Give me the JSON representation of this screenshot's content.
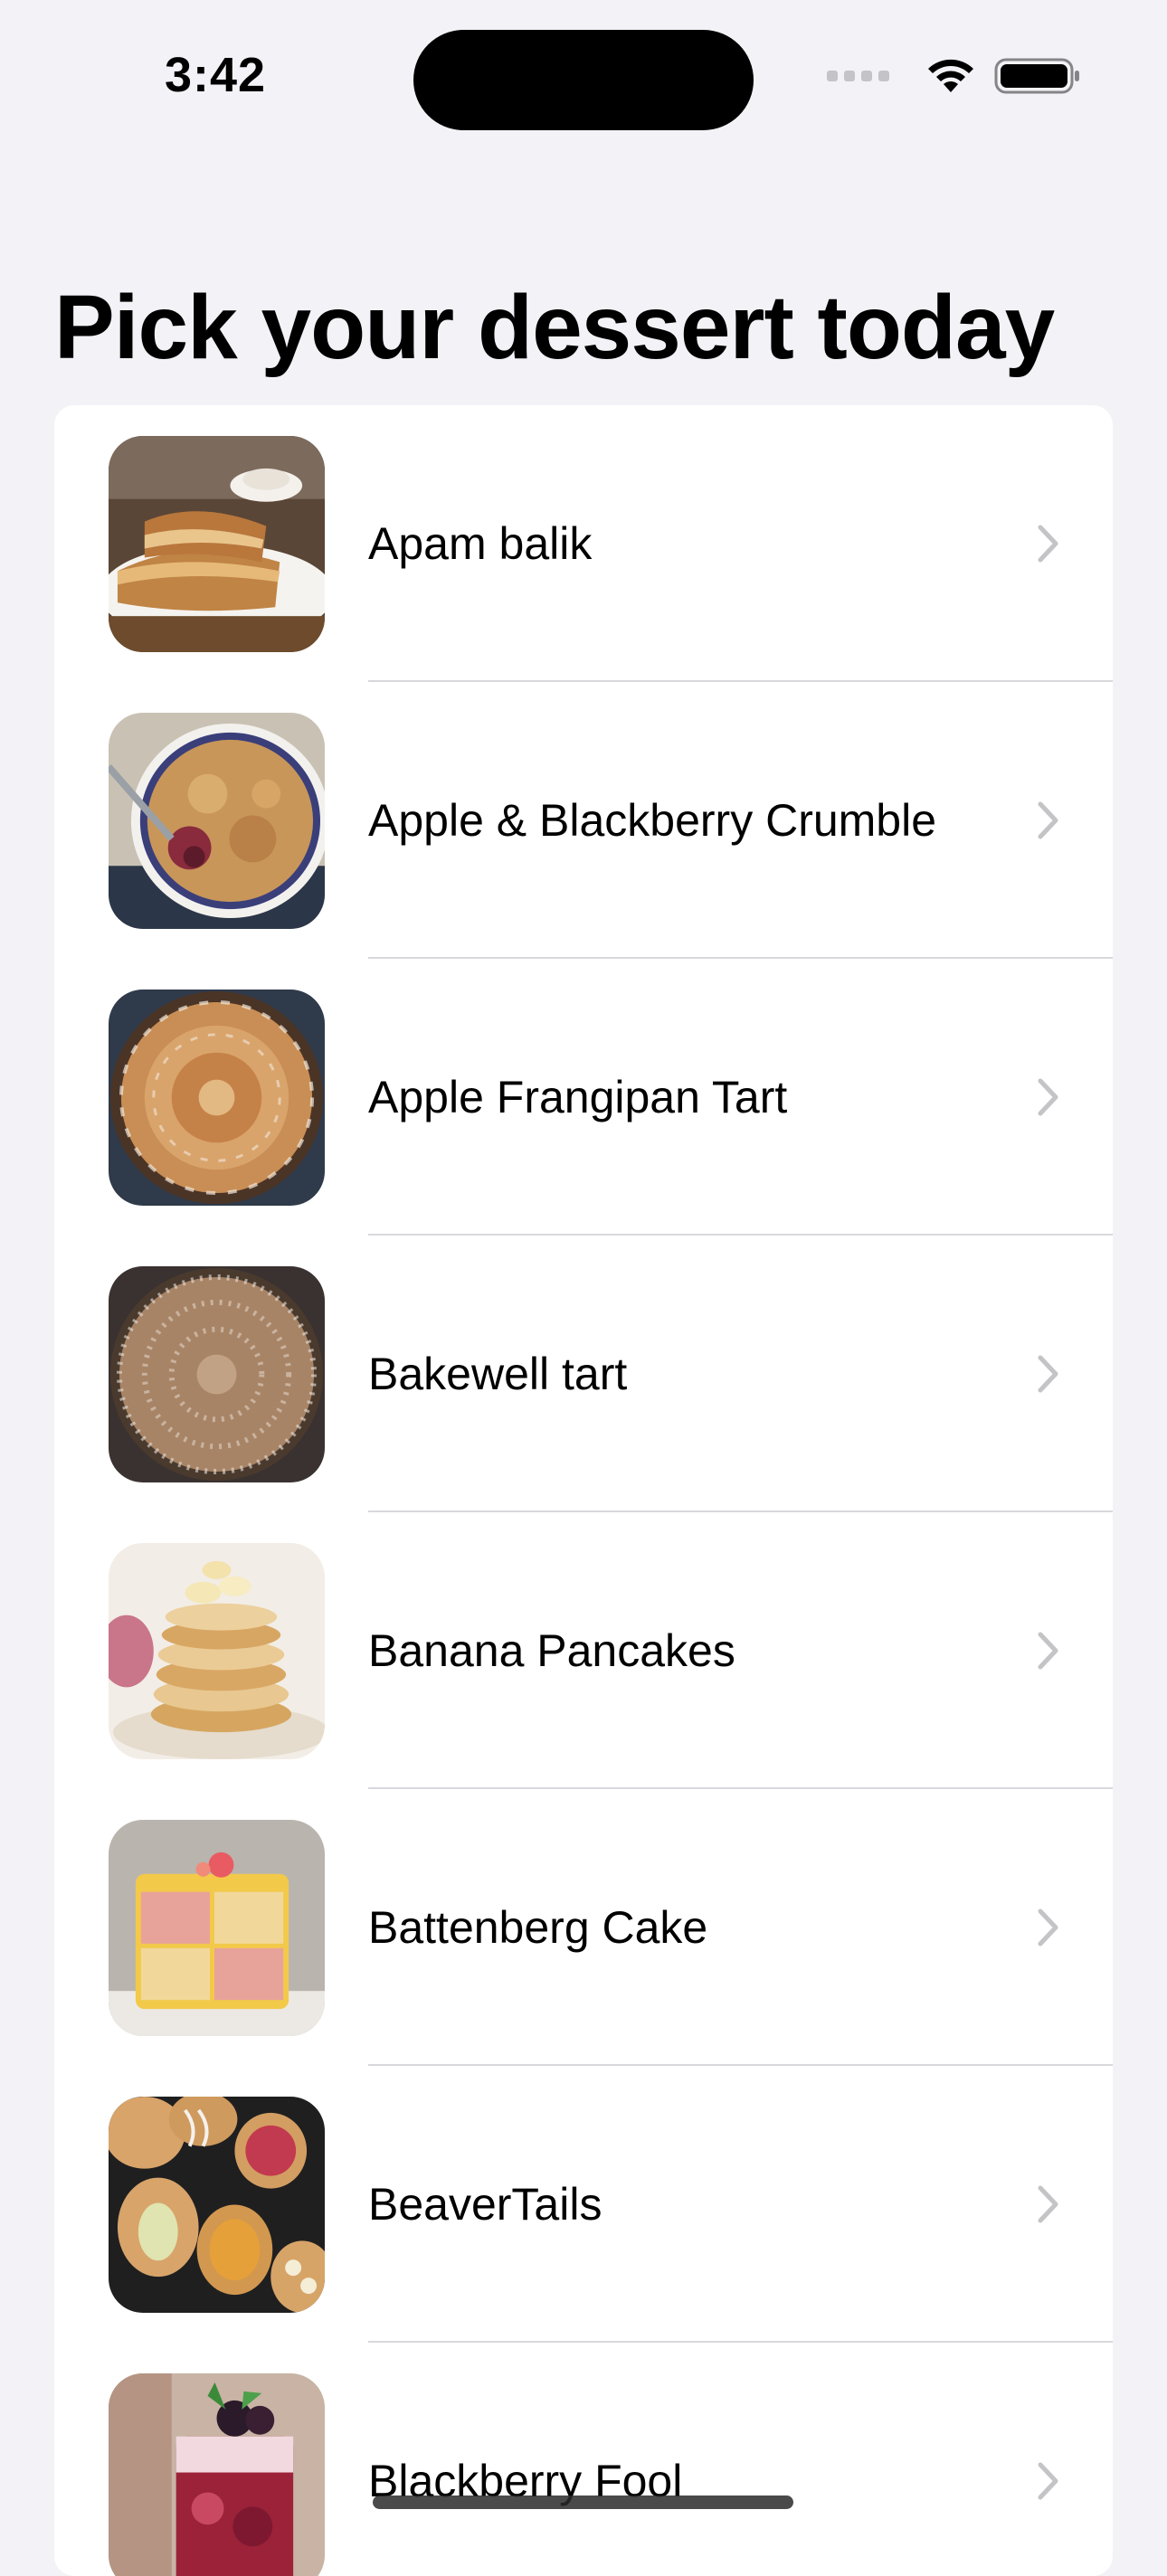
{
  "status_bar": {
    "time": "3:42",
    "icons": [
      "cellular-signal-icon",
      "wifi-icon",
      "battery-icon"
    ]
  },
  "title": "Pick your dessert today",
  "items": [
    {
      "label": "Apam balik",
      "thumb_icon": "apam-balik-thumbnail"
    },
    {
      "label": "Apple & Blackberry Crumble",
      "thumb_icon": "crumble-thumbnail"
    },
    {
      "label": "Apple Frangipan Tart",
      "thumb_icon": "frangipan-tart-thumbnail"
    },
    {
      "label": "Bakewell tart",
      "thumb_icon": "bakewell-tart-thumbnail"
    },
    {
      "label": "Banana Pancakes",
      "thumb_icon": "banana-pancakes-thumbnail"
    },
    {
      "label": "Battenberg Cake",
      "thumb_icon": "battenberg-cake-thumbnail"
    },
    {
      "label": "BeaverTails",
      "thumb_icon": "beavertails-thumbnail"
    },
    {
      "label": "Blackberry Fool",
      "thumb_icon": "blackberry-fool-thumbnail"
    }
  ],
  "colors": {
    "background": "#f2f2f7",
    "card": "#ffffff",
    "chevron": "#c4c4c7",
    "divider": "#d8d8dc"
  }
}
